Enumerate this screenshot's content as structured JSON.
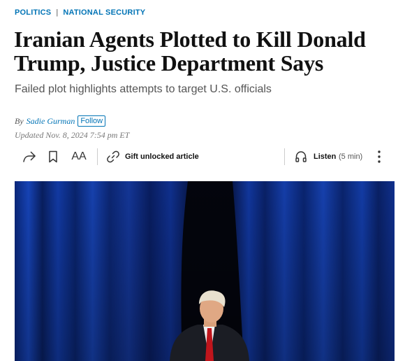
{
  "breadcrumb": {
    "section": "POLITICS",
    "separator": "|",
    "subsection": "NATIONAL SECURITY"
  },
  "article": {
    "headline": "Iranian Agents Plotted to Kill Donald Trump, Justice Department Says",
    "dek": "Failed plot highlights attempts to target U.S. officials",
    "byline_prefix": "By",
    "author": "Sadie Gurman",
    "follow_label": "Follow",
    "updated": "Updated Nov. 8, 2024 7:54 pm ET"
  },
  "toolbar": {
    "font_size_label": "AA",
    "gift_label": "Gift unlocked article",
    "listen_label": "Listen",
    "listen_duration": "(5 min)",
    "icons": [
      "share-icon",
      "bookmark-icon",
      "text-size-icon",
      "link-icon",
      "headphones-icon",
      "more-options-icon"
    ]
  },
  "image": {
    "subject": "photo",
    "colors": {
      "curtain": "#10339a",
      "backdrop": "#050814",
      "suit": "#1b1d24",
      "tie": "#c0151c"
    }
  },
  "colors": {
    "accent": "#0274b6",
    "text": "#111111",
    "muted": "#555555"
  }
}
